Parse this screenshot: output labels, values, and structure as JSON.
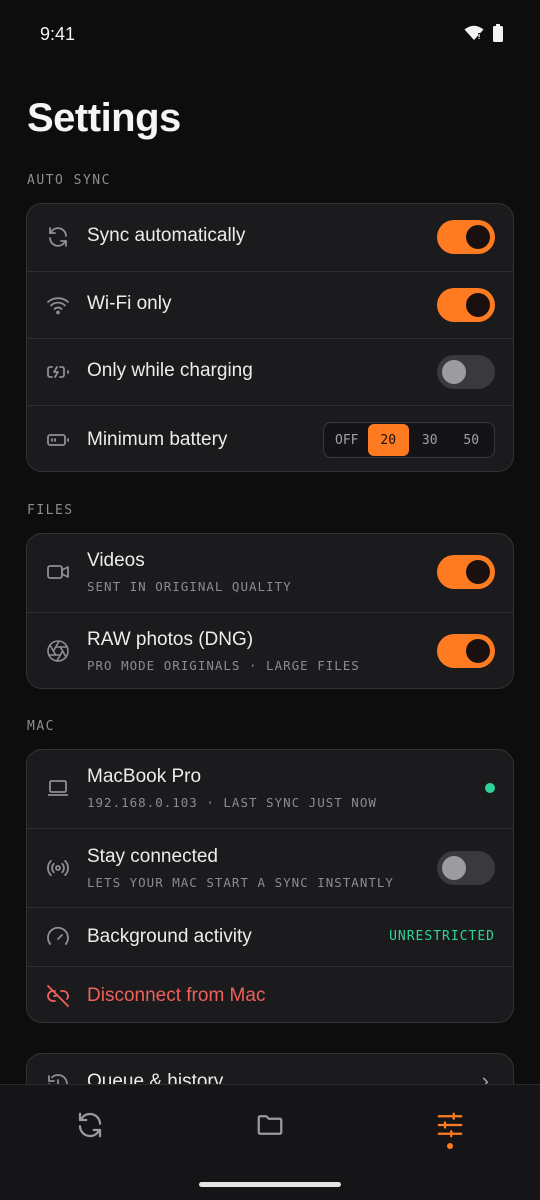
{
  "status": {
    "time": "9:41"
  },
  "page": {
    "title": "Settings"
  },
  "sections": {
    "auto_sync": "AUTO SYNC",
    "files": "FILES",
    "mac": "MAC"
  },
  "auto_sync": {
    "sync_automatically": {
      "label": "Sync automatically",
      "on": true
    },
    "wifi_only": {
      "label": "Wi-Fi only",
      "on": true
    },
    "only_charging": {
      "label": "Only while charging",
      "on": false
    },
    "min_battery": {
      "label": "Minimum battery",
      "options": [
        "OFF",
        "20",
        "30",
        "50"
      ],
      "selected": "20"
    }
  },
  "files": {
    "videos": {
      "label": "Videos",
      "sub": "SENT IN ORIGINAL QUALITY",
      "on": true
    },
    "raw": {
      "label": "RAW photos (DNG)",
      "sub": "PRO MODE ORIGINALS · LARGE FILES",
      "on": true
    }
  },
  "mac": {
    "device": {
      "label": "MacBook Pro",
      "sub": "192.168.0.103 · LAST SYNC JUST NOW",
      "status_color": "#2fd39a"
    },
    "stay_connected": {
      "label": "Stay connected",
      "sub": "LETS YOUR MAC START A SYNC INSTANTLY",
      "on": false
    },
    "background": {
      "label": "Background activity",
      "value": "UNRESTRICTED"
    },
    "disconnect": {
      "label": "Disconnect from Mac"
    }
  },
  "queue": {
    "label": "Queue & history"
  },
  "nav": {
    "items": [
      "sync-icon",
      "folder-icon",
      "sliders-icon"
    ],
    "active": "sliders-icon"
  },
  "colors": {
    "accent": "#ff7b21",
    "success": "#2fd39a",
    "danger": "#f0605a"
  }
}
